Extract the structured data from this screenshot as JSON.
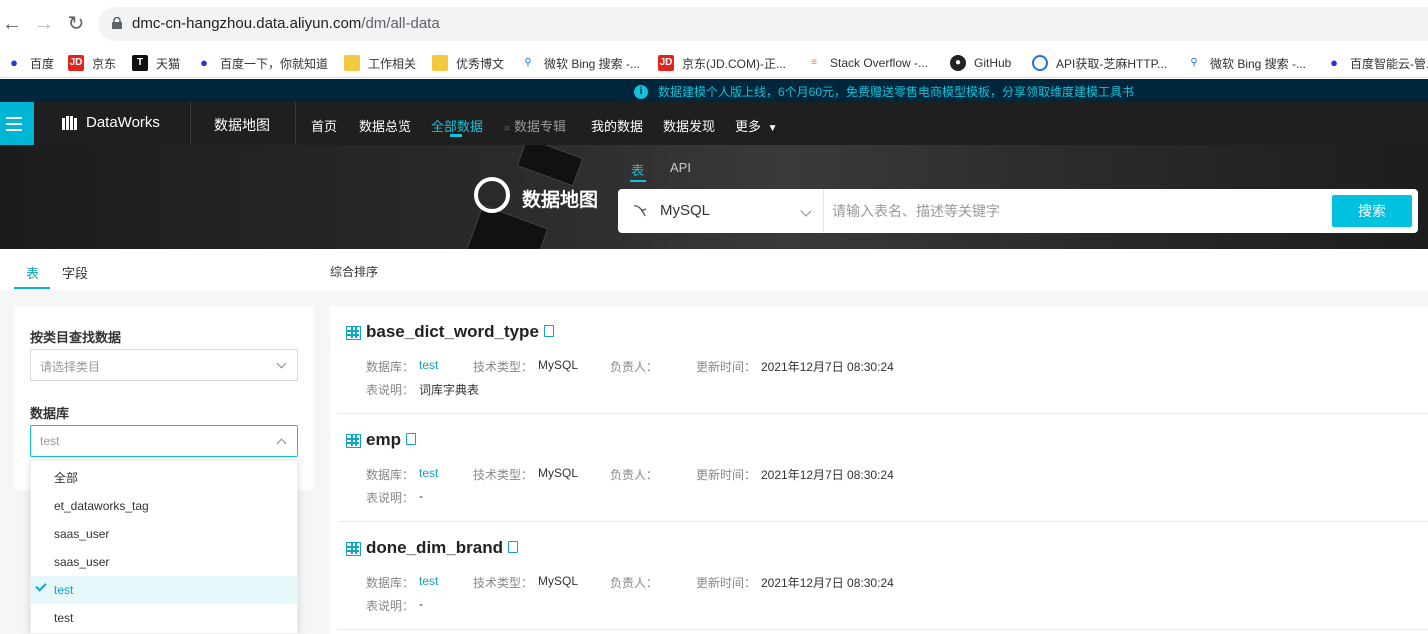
{
  "browser": {
    "url_host": "dmc-cn-hangzhou.data.aliyun.com",
    "url_path": "/dm/all-data"
  },
  "bookmarks": [
    {
      "label": "百度",
      "icon": "baidu-paw-icon",
      "color": "#2932e1"
    },
    {
      "label": "京东",
      "icon": "jd-icon",
      "color": "#e1251b"
    },
    {
      "label": "天猫",
      "icon": "tmall-icon",
      "color": "#ff0036"
    },
    {
      "label": "百度一下，你就知道",
      "icon": "baidu-paw-icon",
      "color": "#2932e1"
    },
    {
      "label": "工作相关",
      "icon": "folder-icon",
      "color": "#f5c842"
    },
    {
      "label": "优秀博文",
      "icon": "folder-icon",
      "color": "#f5c842"
    },
    {
      "label": "微软 Bing 搜索 -...",
      "icon": "bing-search-icon",
      "color": "#1a73e8"
    },
    {
      "label": "京东(JD.COM)-正...",
      "icon": "jd-icon",
      "color": "#e1251b"
    },
    {
      "label": "Stack Overflow -...",
      "icon": "stackoverflow-icon",
      "color": "#f48024"
    },
    {
      "label": "GitHub",
      "icon": "github-icon",
      "color": "#222222"
    },
    {
      "label": "API获取-芝麻HTTP...",
      "icon": "zhima-icon",
      "color": "#1a73e8"
    },
    {
      "label": "微软 Bing 搜索 -...",
      "icon": "bing-search-icon",
      "color": "#1a73e8"
    },
    {
      "label": "百度智能云-管...",
      "icon": "baidu-paw-icon",
      "color": "#2932e1"
    }
  ],
  "notice": "数据建模个人版上线，6个月60元，免费赠送零售电商模型模板，分享领取维度建模工具书",
  "nav": {
    "brand": "DataWorks",
    "product": "数据地图",
    "items": [
      {
        "label": "首页"
      },
      {
        "label": "数据总览"
      },
      {
        "label": "全部数据"
      },
      {
        "label": "数据专辑"
      },
      {
        "label": "我的数据"
      },
      {
        "label": "数据发现"
      },
      {
        "label": "更多"
      }
    ]
  },
  "banner": {
    "title": "数据地图",
    "tabs": [
      {
        "label": "表"
      },
      {
        "label": "API"
      }
    ],
    "db_type": "MySQL",
    "search_placeholder": "请输入表名、描述等关键字",
    "search_button": "搜索"
  },
  "subtabs": [
    {
      "label": "表"
    },
    {
      "label": "字段"
    }
  ],
  "sort_label": "综合排序",
  "sidebar": {
    "category_label": "按类目查找数据",
    "category_placeholder": "请选择类目",
    "db_label": "数据库",
    "db_value": "test",
    "options": [
      {
        "label": "全部"
      },
      {
        "label": "et_dataworks_tag"
      },
      {
        "label": "saas_user"
      },
      {
        "label": "saas_user"
      },
      {
        "label": "test",
        "selected": true
      },
      {
        "label": "test"
      }
    ]
  },
  "meta_labels": {
    "database": "数据库：",
    "tech_type": "技术类型：",
    "owner": "负责人：",
    "updated": "更新时间：",
    "description": "表说明："
  },
  "results": [
    {
      "name": "base_dict_word_type",
      "database": "test",
      "tech_type": "MySQL",
      "owner": "",
      "updated": "2021年12月7日 08:30:24",
      "description": "词库字典表"
    },
    {
      "name": "emp",
      "database": "test",
      "tech_type": "MySQL",
      "owner": "",
      "updated": "2021年12月7日 08:30:24",
      "description": "-"
    },
    {
      "name": "done_dim_brand",
      "database": "test",
      "tech_type": "MySQL",
      "owner": "",
      "updated": "2021年12月7日 08:30:24",
      "description": "-"
    }
  ]
}
